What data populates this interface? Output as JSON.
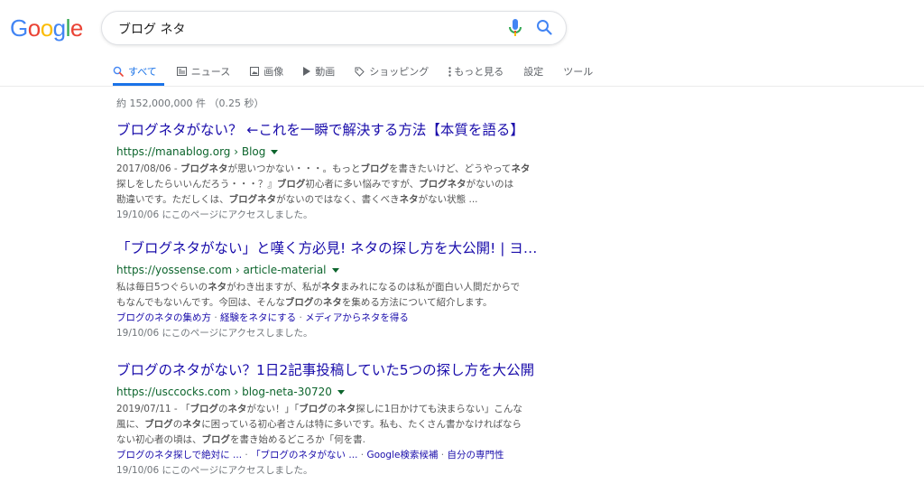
{
  "logo": {
    "letters": [
      {
        "ch": "G",
        "color": "#4285F4"
      },
      {
        "ch": "o",
        "color": "#EA4335"
      },
      {
        "ch": "o",
        "color": "#FBBC05"
      },
      {
        "ch": "g",
        "color": "#4285F4"
      },
      {
        "ch": "l",
        "color": "#34A853"
      },
      {
        "ch": "e",
        "color": "#EA4335"
      }
    ]
  },
  "search": {
    "value": "ブログ ネタ"
  },
  "icons": {
    "mic": "mic-icon",
    "search": "search-icon"
  },
  "tabs": [
    {
      "label": "すべて",
      "icon": "search-icon",
      "active": true
    },
    {
      "label": "ニュース",
      "icon": "news-icon",
      "active": false
    },
    {
      "label": "画像",
      "icon": "image-icon",
      "active": false
    },
    {
      "label": "動画",
      "icon": "video-icon",
      "active": false
    },
    {
      "label": "ショッピング",
      "icon": "tag-icon",
      "active": false
    },
    {
      "label": "もっと見る",
      "icon": "more-icon",
      "active": false
    },
    {
      "label": "設定",
      "icon": "",
      "active": false
    },
    {
      "label": "ツール",
      "icon": "",
      "active": false
    }
  ],
  "stats": "約 152,000,000 件 （0.25 秒）",
  "results": [
    {
      "title": "ブログネタがない？ ←これを一瞬で解決する方法【本質を語る】",
      "url": "https://manablog.org › Blog",
      "snippet_lines": [
        "2017/08/06 - <b>ブログネタ</b>が思いつかない・・・。もっと<b>ブログ</b>を書きたいけど、どうやって<b>ネタ</b>",
        "探しをしたらいいんだろう・・・？』<b>ブログ</b>初心者に多い悩みですが、<b>ブログネタ</b>がないのは",
        "勘違いです。ただしくは、<b>ブログネタ</b>がないのではなく、書くべき<b>ネタ</b>がない状態 ..."
      ],
      "sitelinks": [],
      "visited": "19/10/06 にこのページにアクセスしました。"
    },
    {
      "title": "「ブログネタがない」と嘆く方必見! ネタの探し方を大公開! | ヨ…",
      "url": "https://yossense.com › article-material",
      "snippet_lines": [
        "私は毎日5つぐらいの<b>ネタ</b>がわき出ますが、私が<b>ネタ</b>まみれになるのは私が面白い人間だからで",
        "もなんでもないんです。今回は、そんな<b>ブログ</b>の<b>ネタ</b>を集める方法について紹介します。"
      ],
      "sitelinks": [
        "ブログのネタの集め方",
        "経験をネタにする",
        "メディアからネタを得る"
      ],
      "visited": "19/10/06 にこのページにアクセスしました。"
    },
    {
      "title": "ブログのネタがない？1日2記事投稿していた5つの探し方を大公開",
      "url": "https://usccocks.com › blog-neta-30720",
      "snippet_lines": [
        "2019/07/11 - 「<b>ブログ</b>の<b>ネタ</b>がない！」「<b>ブログ</b>の<b>ネタ</b>探しに1日かけても決まらない」こんな",
        "風に、<b>ブログ</b>の<b>ネタ</b>に困っている初心者さんは特に多いです。私も、たくさん書かなければなら",
        "ない初心者の頃は、<b>ブログ</b>を書き始めるどころか「何を書."
      ],
      "sitelinks": [
        "ブログのネタ探しで絶対に ...",
        "「ブログのネタがない ...",
        "Google検索候補",
        "自分の専門性"
      ],
      "visited": "19/10/06 にこのページにアクセスしました。"
    }
  ]
}
